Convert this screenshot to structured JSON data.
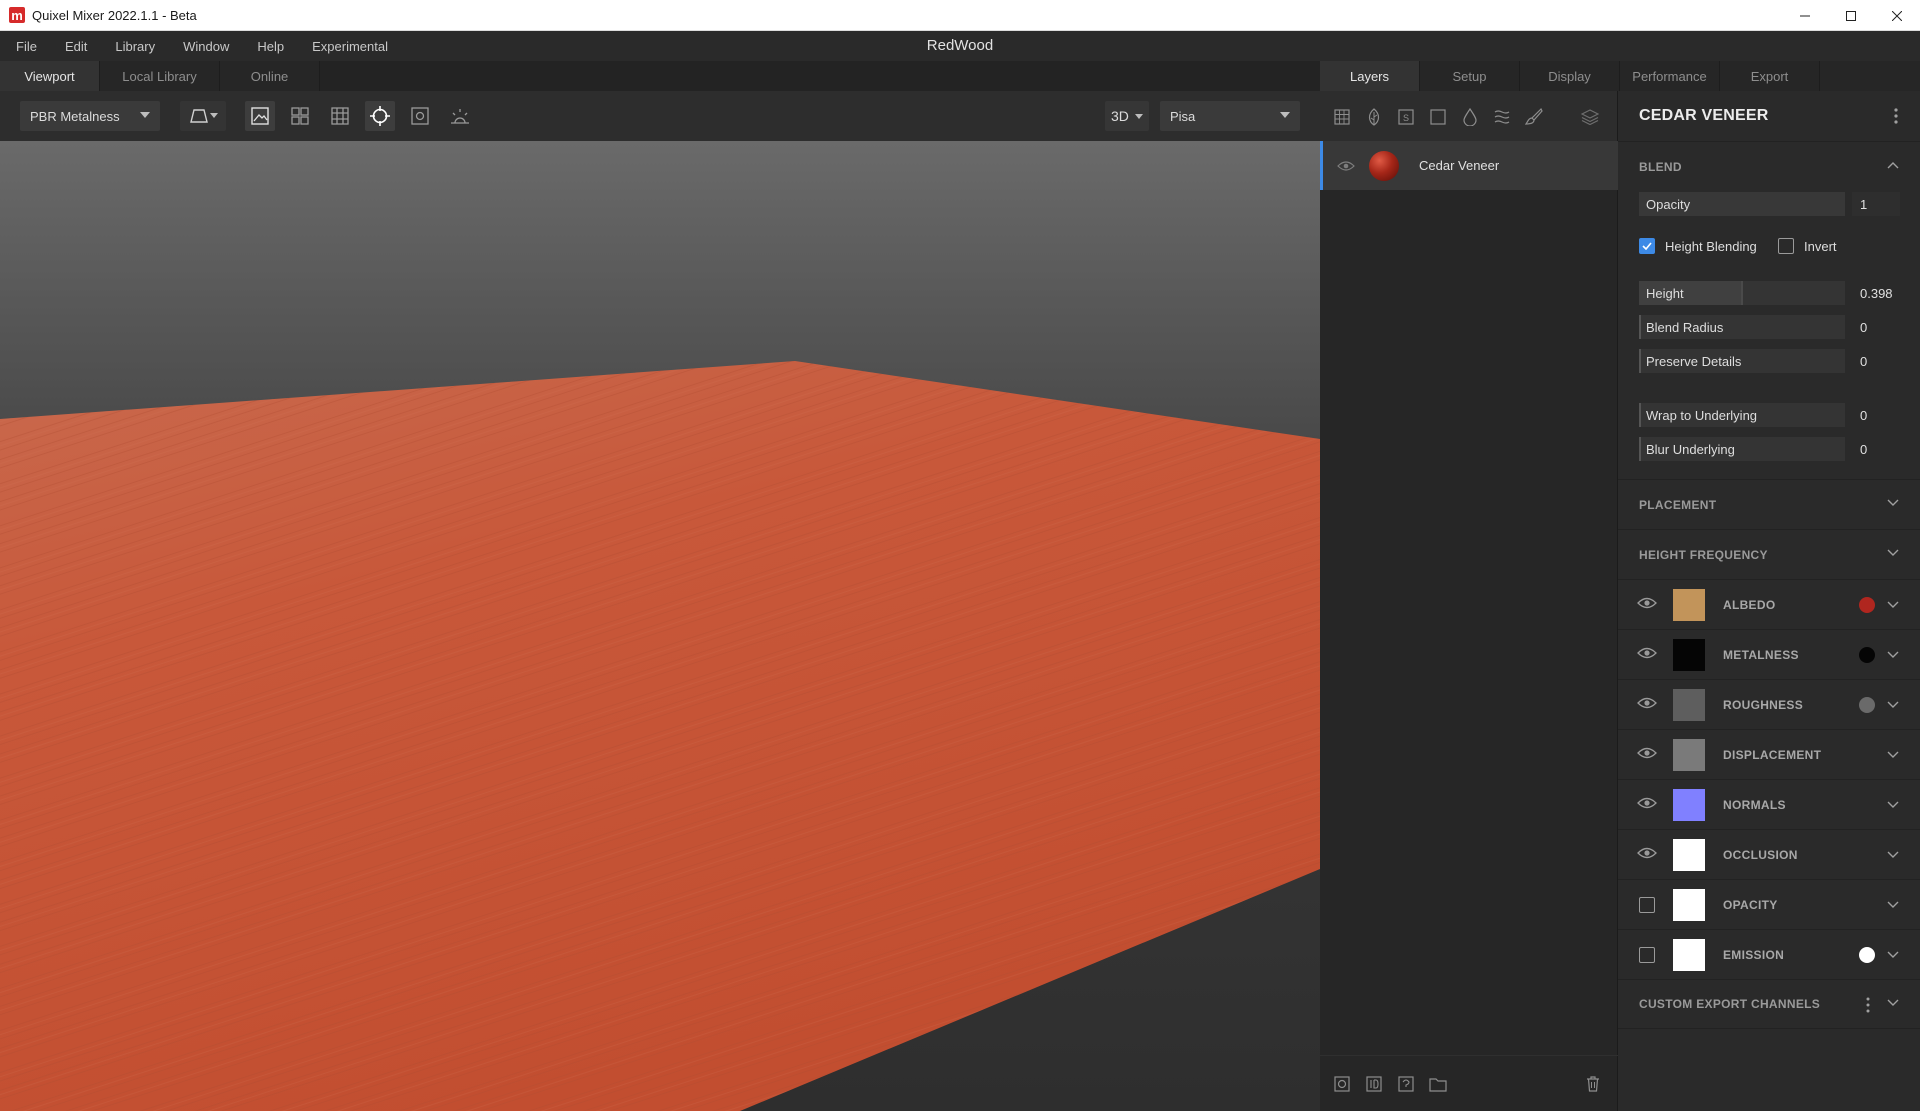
{
  "window": {
    "title": "Quixel Mixer 2022.1.1 - Beta",
    "document_title": "RedWood"
  },
  "menu": [
    "File",
    "Edit",
    "Library",
    "Window",
    "Help",
    "Experimental"
  ],
  "left_tabs": [
    "Viewport",
    "Local Library",
    "Online"
  ],
  "viewport_toolbar": {
    "render_mode": "PBR Metalness",
    "view_mode": "3D",
    "environment": "Pisa"
  },
  "right_tabs": [
    "Layers",
    "Setup",
    "Display",
    "Performance",
    "Export"
  ],
  "layers": [
    {
      "name": "Cedar Veneer",
      "selected": true,
      "visible": true
    }
  ],
  "properties": {
    "title": "CEDAR VENEER",
    "blend": {
      "header": "BLEND",
      "opacity_label": "Opacity",
      "opacity_value": "1",
      "height_blending_label": "Height Blending",
      "height_blending_checked": true,
      "invert_label": "Invert",
      "invert_checked": false,
      "height_label": "Height",
      "height_value": "0.398",
      "blend_radius_label": "Blend Radius",
      "blend_radius_value": "0",
      "preserve_details_label": "Preserve Details",
      "preserve_details_value": "0",
      "wrap_label": "Wrap to Underlying",
      "wrap_value": "0",
      "blur_label": "Blur Underlying",
      "blur_value": "0"
    },
    "placement_header": "PLACEMENT",
    "height_frequency_header": "HEIGHT FREQUENCY",
    "channels": [
      {
        "name": "ALBEDO",
        "visible": true,
        "swatch": "#c2945a",
        "dot": "#b0261f"
      },
      {
        "name": "METALNESS",
        "visible": true,
        "swatch": "#050505",
        "dot": "#050505"
      },
      {
        "name": "ROUGHNESS",
        "visible": true,
        "swatch": "#5e5e5e",
        "dot": "#6a6a6a"
      },
      {
        "name": "DISPLACEMENT",
        "visible": true,
        "swatch": "#7a7a7a",
        "dot": ""
      },
      {
        "name": "NORMALS",
        "visible": true,
        "swatch": "#8080ff",
        "dot": ""
      },
      {
        "name": "OCCLUSION",
        "visible": true,
        "swatch": "#ffffff",
        "dot": ""
      },
      {
        "name": "OPACITY",
        "visible": false,
        "swatch": "#ffffff",
        "dot": ""
      },
      {
        "name": "EMISSION",
        "visible": false,
        "swatch": "#ffffff",
        "dot": "#ffffff"
      }
    ],
    "custom_export_header": "CUSTOM EXPORT CHANNELS"
  },
  "colors": {
    "accent": "#3d8ae6",
    "wood": "#c5553a"
  }
}
